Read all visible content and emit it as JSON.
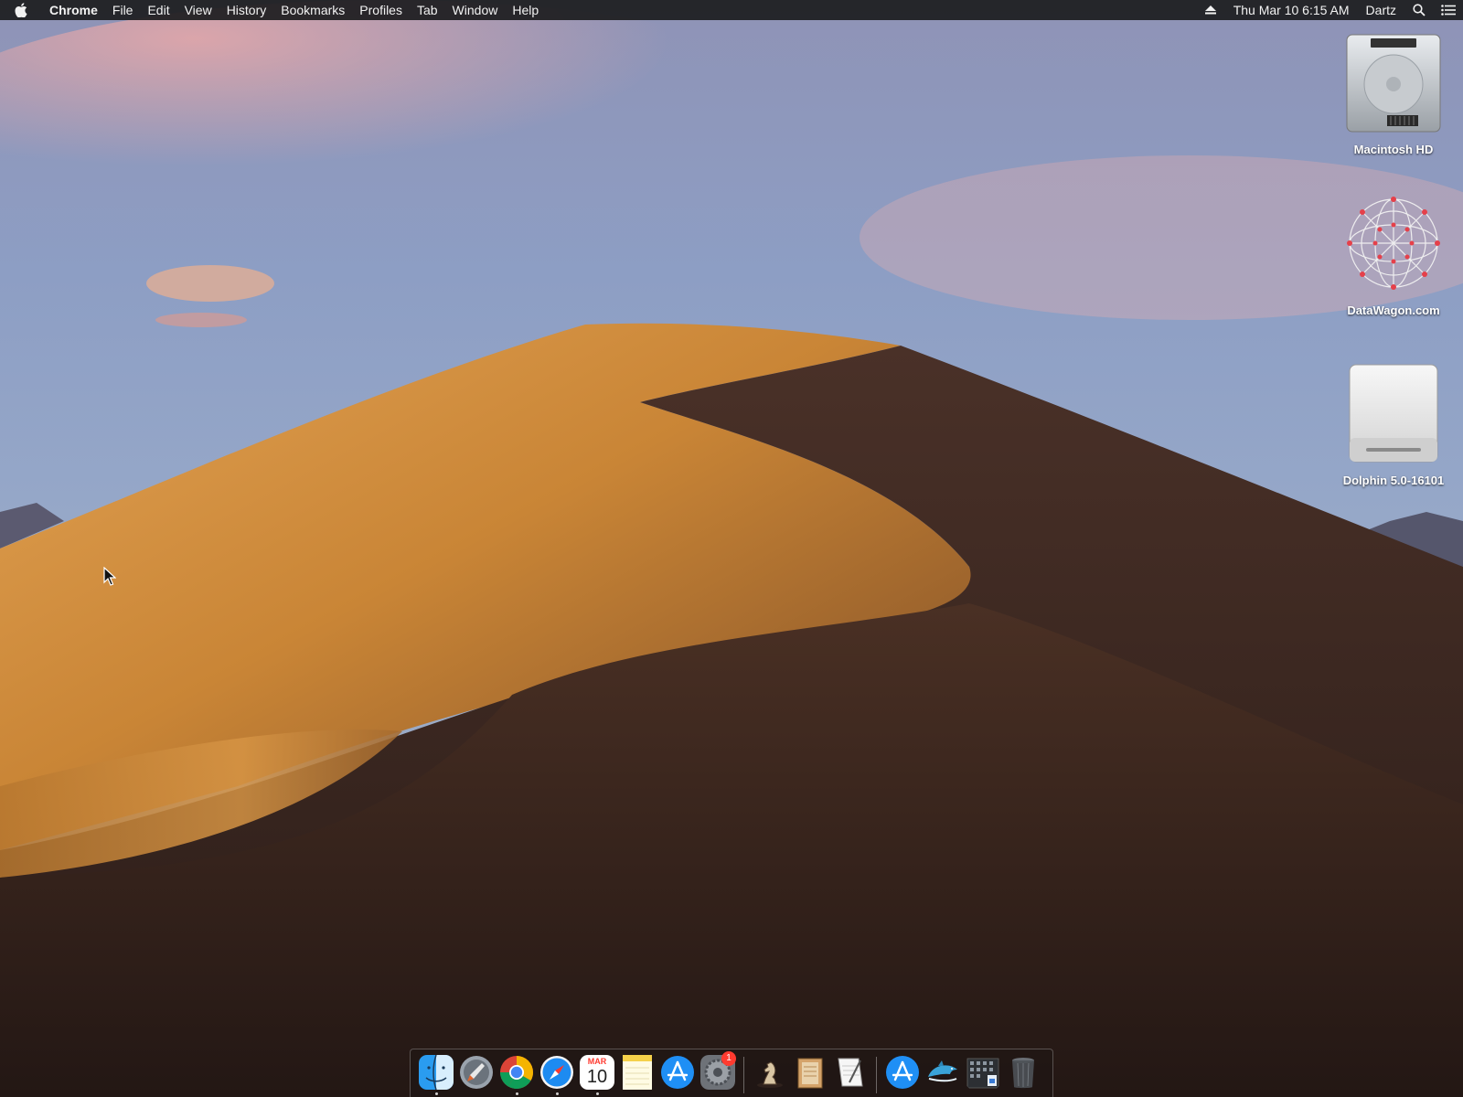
{
  "menubar": {
    "app_name": "Chrome",
    "menus": [
      "File",
      "Edit",
      "View",
      "History",
      "Bookmarks",
      "Profiles",
      "Tab",
      "Window",
      "Help"
    ],
    "datetime": "Thu Mar 10  6:15 AM",
    "user": "Dartz"
  },
  "desktop_icons": [
    {
      "label": "Macintosh HD",
      "icon": "hard-drive-icon"
    },
    {
      "label": "DataWagon.com",
      "icon": "network-globe-icon"
    },
    {
      "label": "Dolphin 5.0-16101",
      "icon": "external-drive-icon"
    }
  ],
  "dock": {
    "apps": [
      {
        "name": "Finder",
        "icon": "finder-icon",
        "running": true
      },
      {
        "name": "Launchpad",
        "icon": "launchpad-icon",
        "running": false
      },
      {
        "name": "Google Chrome",
        "icon": "chrome-icon",
        "running": true
      },
      {
        "name": "Safari",
        "icon": "safari-icon",
        "running": true
      },
      {
        "name": "Calendar",
        "icon": "calendar-icon",
        "running": true,
        "month": "MAR",
        "day": "10"
      },
      {
        "name": "Notes",
        "icon": "notes-icon",
        "running": false
      },
      {
        "name": "App Store",
        "icon": "app-store-icon",
        "running": false
      },
      {
        "name": "System Preferences",
        "icon": "system-preferences-icon",
        "running": false,
        "badge": "1"
      },
      {
        "name": "Chess",
        "icon": "chess-icon",
        "running": false
      },
      {
        "name": "Library",
        "icon": "library-icon",
        "running": false
      },
      {
        "name": "TextEdit",
        "icon": "textedit-icon",
        "running": false
      },
      {
        "name": "App Store Folder",
        "icon": "app-store-folder-icon",
        "running": false
      },
      {
        "name": "Dolphin",
        "icon": "dolphin-icon",
        "running": false
      },
      {
        "name": "Downloads Stack",
        "icon": "downloads-stack-icon",
        "running": false
      },
      {
        "name": "Trash",
        "icon": "trash-icon",
        "running": false
      }
    ]
  },
  "colors": {
    "menubar_bg": "#1c1c1e",
    "sky_top": "#7f90b8",
    "dune_light": "#d9923f",
    "dune_shadow": "#3a2620",
    "badge": "#ff3b30"
  }
}
